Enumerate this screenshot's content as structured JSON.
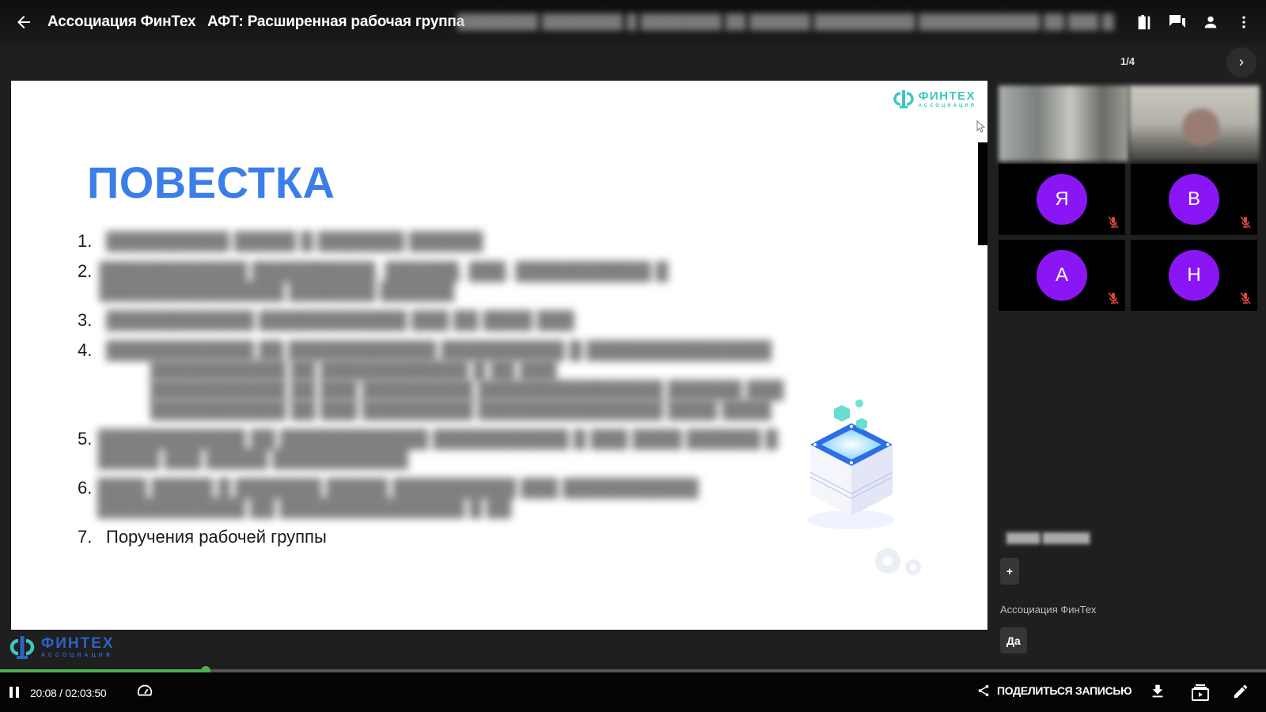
{
  "header": {
    "back_icon": "arrow-left-icon",
    "org_name": "Ассоциация ФинТех",
    "event_title": "АФТ: Расширенная рабочая группа",
    "event_subtitle_redacted": "████████ ████████ █ ████████ ██ ██████ ██████████ ████████████ ██ ███ ████████████",
    "icons": [
      "notes-icon",
      "chat-icon",
      "participants-icon",
      "more-vert-icon"
    ]
  },
  "pager": {
    "page_indicator": "1/4",
    "next_icon": "chevron-right-icon"
  },
  "slide": {
    "logo_main": "ФИНТЕХ",
    "logo_sub": "АССОЦИАЦИЯ",
    "title": "ПОВЕСТКА",
    "agenda": [
      {
        "num": "1.",
        "text": "██████████ █████ █ ███████ ██████",
        "redacted": true,
        "sub": []
      },
      {
        "num": "2.",
        "text": "████████████ ██████████, ██████, ███, ███████████ █ ███████████████ ███████ ██████",
        "redacted": true,
        "sub": []
      },
      {
        "num": "3.",
        "text": "████████████ ████████████ ███ ██ ████ ███",
        "redacted": true,
        "sub": []
      },
      {
        "num": "4.",
        "text": "████████████ ██ ████████████ ██████████ █ ███████████████",
        "redacted": true,
        "sub": [
          "███████████ ██ ████████████ █ ██ ███",
          "███████████ ██ ███ █████████ ███████████████ ██████ ███",
          "███████████ ██ ███ █████████ ███████████████ ████ ████"
        ]
      },
      {
        "num": "5.",
        "text": "████████████ ██ ████████████ ███████████ █ ███ ████ ██████ █ █████ ███ █████ ███████████",
        "redacted": true,
        "sub": []
      },
      {
        "num": "6.",
        "text": "████ █████ █ ███████ █████ ██████████ ███ ███████████ ████████████ ██ ███████████████ █ ██",
        "redacted": true,
        "sub": []
      },
      {
        "num": "7.",
        "text": "Поручения рабочей группы",
        "redacted": false,
        "sub": []
      }
    ]
  },
  "participants": {
    "video_feeds": [
      "participant-video-1",
      "participant-video-2"
    ],
    "tiles": [
      {
        "initial": "Я",
        "muted": true
      },
      {
        "initial": "В",
        "muted": true
      },
      {
        "initial": "А",
        "muted": true
      },
      {
        "initial": "Н",
        "muted": true
      }
    ],
    "avatar_color": "#8b16f5",
    "mic_off_color": "#e0473e"
  },
  "chat": {
    "redacted_name": "█████ ███████",
    "plus_label": "+",
    "author": "Ассоциация ФинТех",
    "message": "Да"
  },
  "footer_logo": {
    "main": "ФИНТЕХ",
    "sub": "АССОЦИАЦИЯ"
  },
  "player": {
    "current_time": "20:08",
    "total_time": "02:03:50",
    "time_display": "20:08 / 02:03:50",
    "progress_fraction": 0.1626,
    "accent_color": "#4caf50",
    "share_label": "ПОДЕЛИТЬСЯ ЗАПИСЬЮ",
    "icons": [
      "pause-icon",
      "playback-speed-icon",
      "share-icon",
      "download-icon",
      "playlist-icon",
      "edit-icon"
    ]
  }
}
